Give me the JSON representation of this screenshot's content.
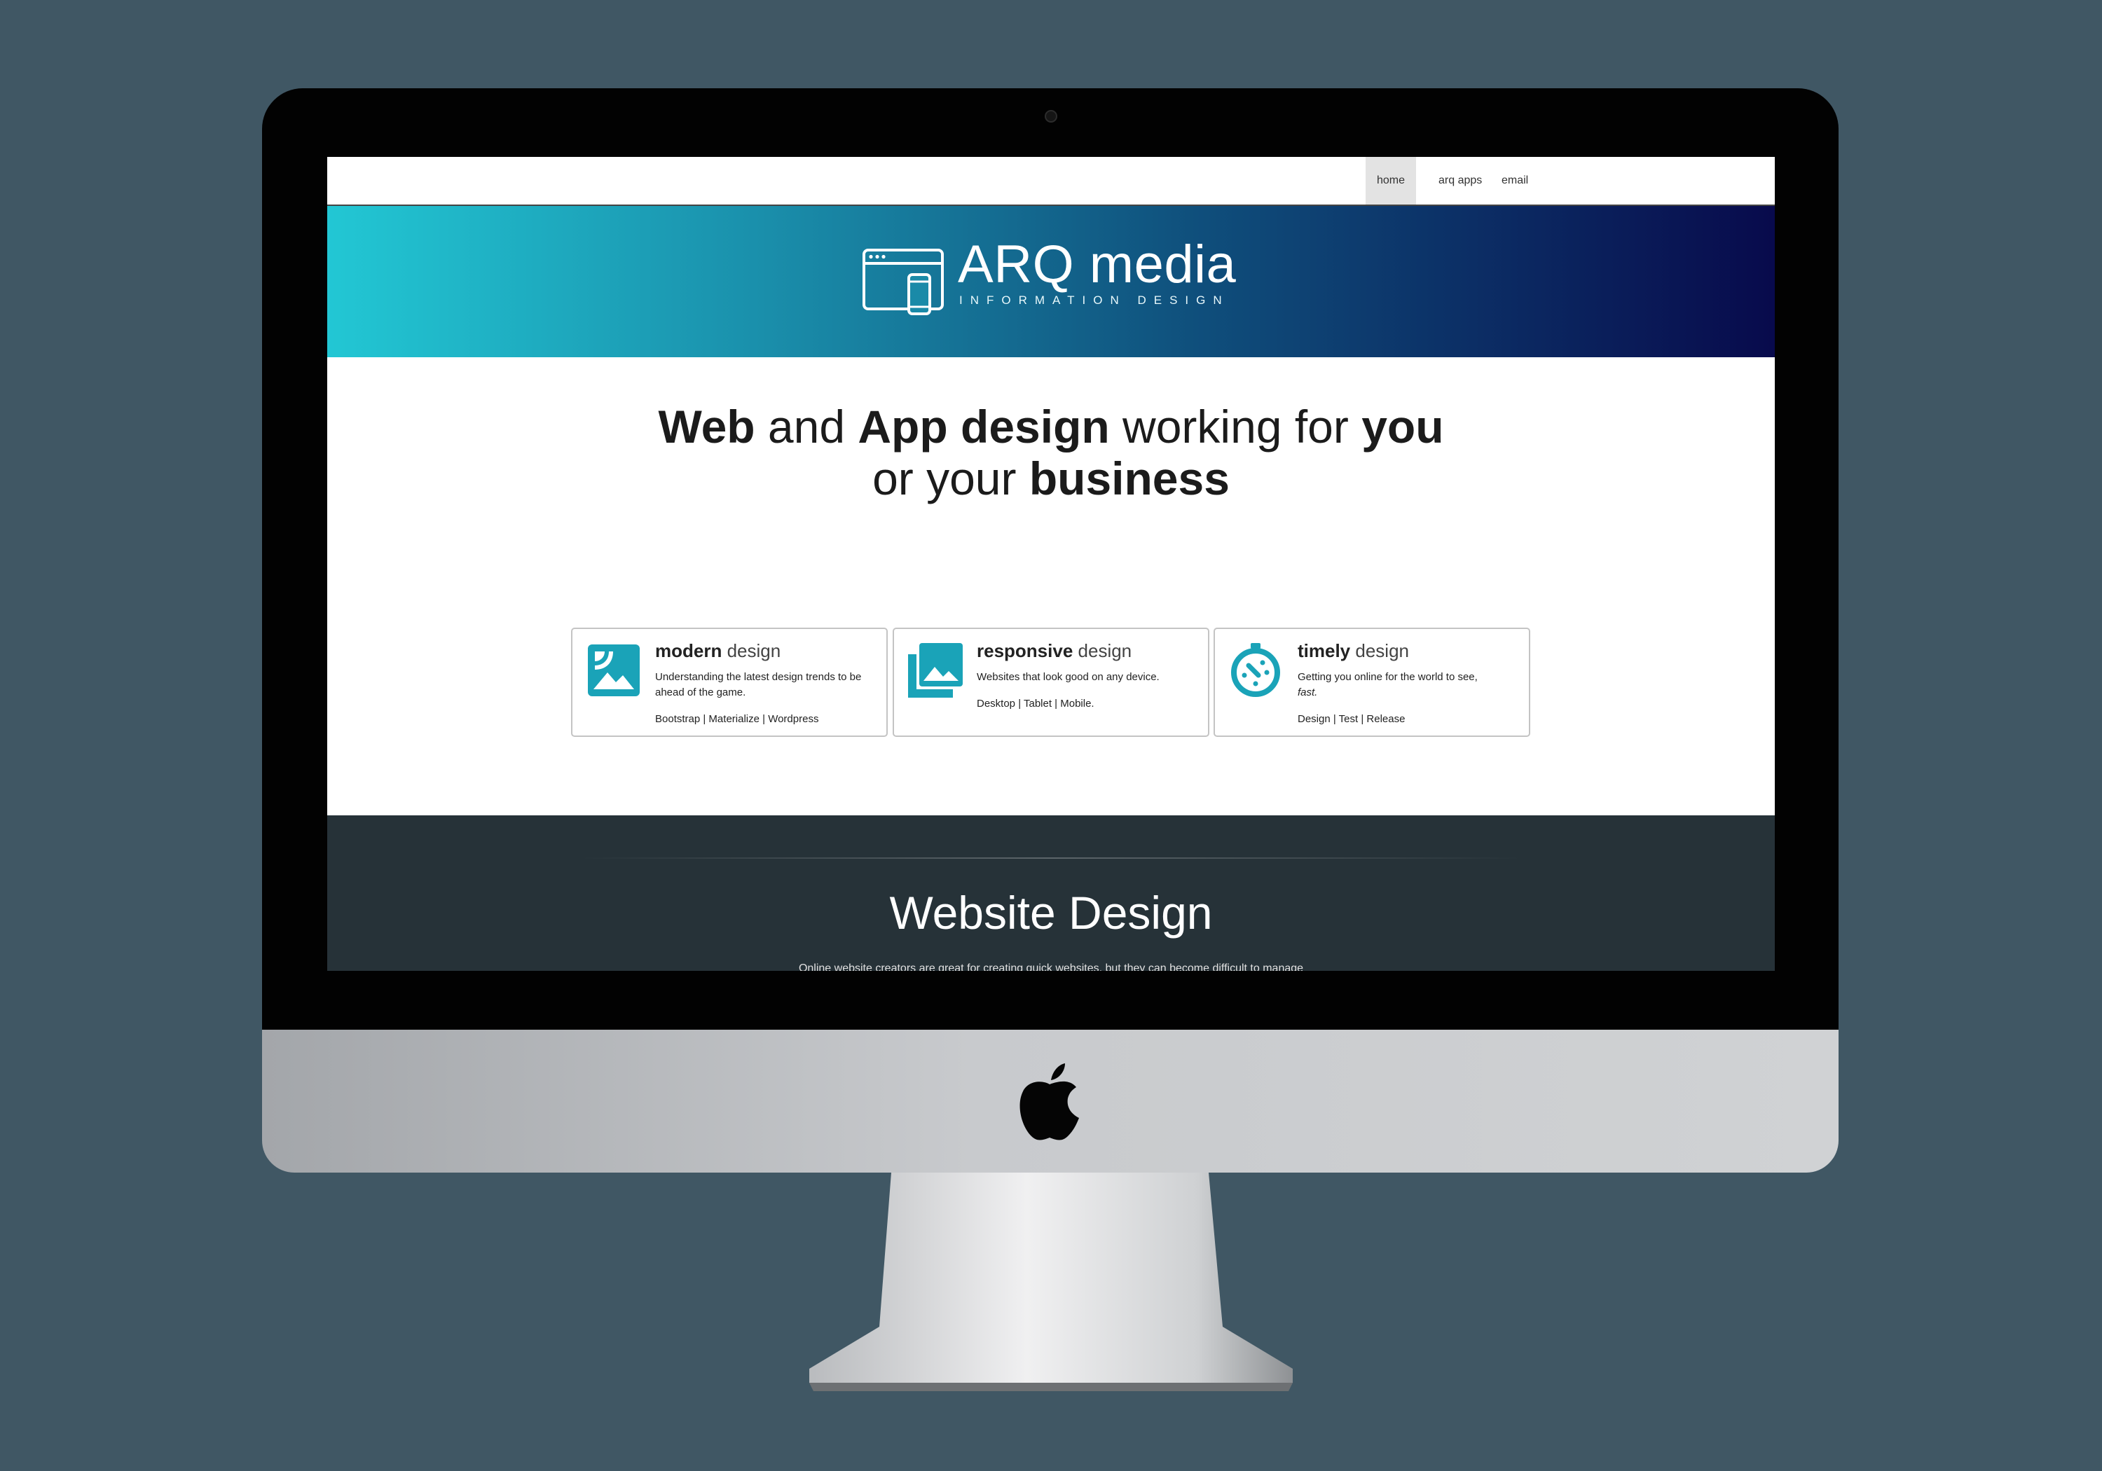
{
  "nav": {
    "items": [
      {
        "label": "home"
      },
      {
        "label": "arq apps"
      },
      {
        "label": "email"
      }
    ],
    "active": "home"
  },
  "brand": {
    "name": "ARQ media",
    "tagline": "INFORMATION DESIGN",
    "icon": "browser-and-phone-icon"
  },
  "hero": {
    "line1": {
      "w1": "Web",
      "w2": " and ",
      "w3": "App design",
      "w4": " working for ",
      "w5": "you"
    },
    "line2": {
      "w1": "or your ",
      "w2": "business"
    }
  },
  "cards": [
    {
      "title_bold": "modern",
      "title_light": " design",
      "description": "Understanding the latest design trends to be ahead of the game.",
      "links": "Bootstrap | Materialize | Wordpress",
      "icon": "image-icon"
    },
    {
      "title_bold": "responsive",
      "title_light": " design",
      "description": "Websites that look good on any device.",
      "links": "Desktop | Tablet | Mobile.",
      "icon": "image-stack-icon"
    },
    {
      "title_bold": "timely",
      "title_light": " design",
      "description": "Getting you online for the world to see,",
      "description_em": "fast.",
      "links": "Design | Test | Release",
      "icon": "timer-icon"
    }
  ],
  "section": {
    "title": "Website Design",
    "body": "Online website creators are great for creating quick websites, but they can become difficult to manage"
  },
  "colors": {
    "background": "#405764",
    "accent": "#1aa3b8",
    "gradient_start": "#22c7d4",
    "gradient_end": "#080a4c",
    "dark_section": "#263238"
  },
  "device": {
    "logo": "apple-logo-icon"
  }
}
